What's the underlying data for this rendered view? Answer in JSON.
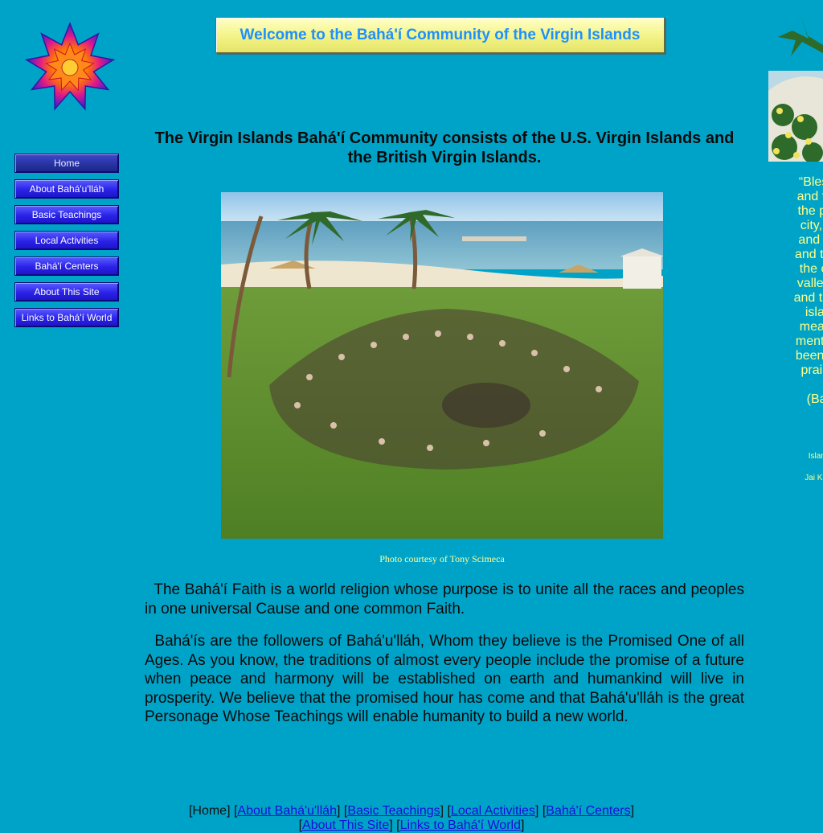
{
  "banner": {
    "title": "Welcome to the Bahá'í Community of the Virgin Islands"
  },
  "nav": {
    "items": [
      {
        "label": "Home"
      },
      {
        "label": "About Bahá'u'lláh"
      },
      {
        "label": "Basic Teachings"
      },
      {
        "label": "Local Activities"
      },
      {
        "label": "Bahá'í Centers"
      },
      {
        "label": "About This Site"
      },
      {
        "label": "Links to Bahá'í World"
      }
    ]
  },
  "main": {
    "headline": "The Virgin Islands Bahá'í Community consists of the U.S. Virgin Islands and the British Virgin Islands.",
    "photo_caption": "Photo courtesy of Tony Scimeca",
    "paragraphs": [
      "The Bahá'í Faith is a world religion whose purpose is to unite all the races and peoples in one universal Cause and one common Faith.",
      "Bahá'ís are the followers of Bahá'u'lláh, Whom they believe is the Promised One of all Ages.  As you know, the traditions of almost every people include the promise of a future when peace and harmony will be established on earth and humankind will live in prosperity.  We believe that the promised hour has come and that Bahá'u'lláh is the great Personage Whose Teachings will enable humanity to build a new world."
    ]
  },
  "footer": {
    "current": "Home",
    "links": [
      "About Bahá'u'lláh",
      "Basic Teachings",
      "Local Activities",
      "Bahá'í Centers",
      "About This Site",
      "Links to Bahá'í World"
    ]
  },
  "sidebar_right": {
    "quote_lines": [
      "“Blessed",
      "and the h",
      "the place",
      "city, and",
      "and the r",
      "and the re",
      "the cave",
      "valley, an",
      "and the se",
      "island,",
      "meadow",
      "mention o",
      "been mac",
      "praise g"
    ],
    "attribution": "(Bahá",
    "credit_1": "Island Gr",
    "credit_2": "Jai Kenyatt"
  },
  "colors": {
    "page_background": "#00a3c8",
    "banner_text": "#1e90ff",
    "nav_button": "#2a22e8",
    "caption_text": "#ffff99",
    "quote_text": "#ffff88",
    "link": "#1a0dd8"
  },
  "icons": {
    "logo": "nine-pointed-star-icon"
  }
}
